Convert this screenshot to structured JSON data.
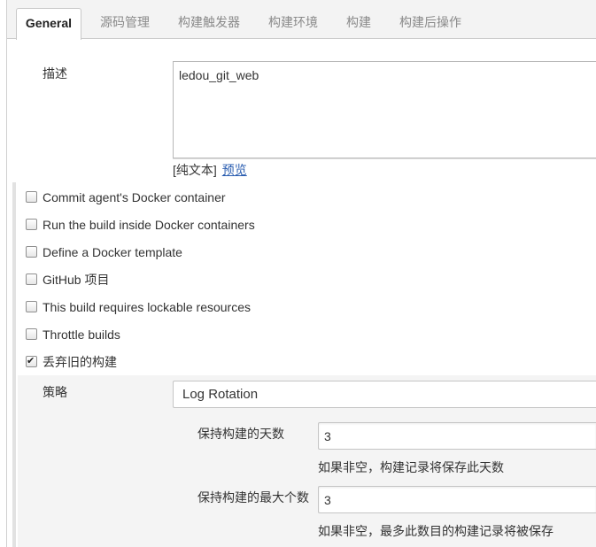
{
  "tabs": [
    {
      "label": "General",
      "active": true
    },
    {
      "label": "源码管理",
      "active": false
    },
    {
      "label": "构建触发器",
      "active": false
    },
    {
      "label": "构建环境",
      "active": false
    },
    {
      "label": "构建",
      "active": false
    },
    {
      "label": "构建后操作",
      "active": false
    }
  ],
  "description": {
    "label": "描述",
    "value": "ledou_git_web",
    "format_text": "[纯文本]",
    "preview_link": "预览"
  },
  "options": [
    {
      "label": "Commit agent's Docker container",
      "checked": false
    },
    {
      "label": "Run the build inside Docker containers",
      "checked": false
    },
    {
      "label": "Define a Docker template",
      "checked": false
    },
    {
      "label": "GitHub 项目",
      "checked": false
    },
    {
      "label": "This build requires lockable resources",
      "checked": false
    },
    {
      "label": "Throttle builds",
      "checked": false
    },
    {
      "label": "丢弃旧的构建",
      "checked": true
    }
  ],
  "discard_old_builds": {
    "strategy_label": "策略",
    "strategy_value": "Log Rotation",
    "days_label": "保持构建的天数",
    "days_value": "3",
    "days_help": "如果非空，构建记录将保存此天数",
    "max_label": "保持构建的最大个数",
    "max_value": "3",
    "max_help": "如果非空，最多此数目的构建记录将被保存"
  },
  "colors": {
    "link": "#2a5db0"
  }
}
